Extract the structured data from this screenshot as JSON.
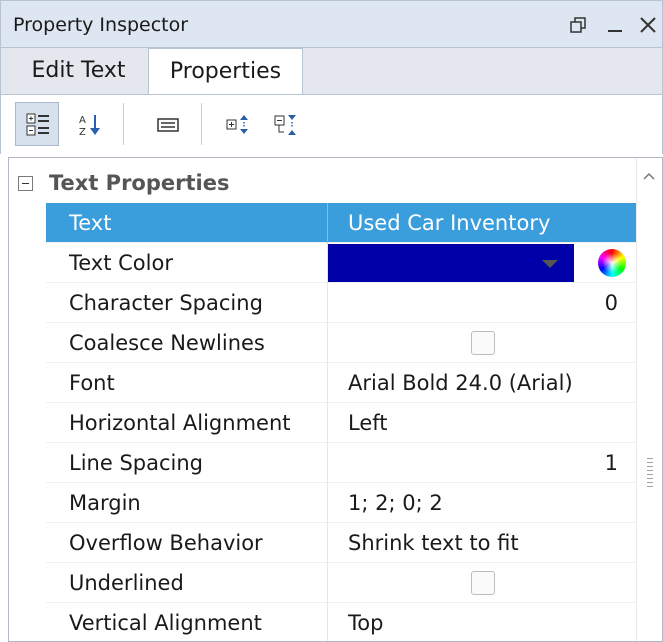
{
  "window": {
    "title": "Property Inspector",
    "buttons": [
      "restore-icon",
      "minimize-icon",
      "close-icon"
    ]
  },
  "tabs": [
    {
      "label": "Edit Text",
      "active": false
    },
    {
      "label": "Properties",
      "active": true
    }
  ],
  "toolbar": {
    "buttons": [
      "categorized-icon",
      "sort-alphabetical-icon",
      "property-pages-icon",
      "expand-all-icon",
      "collapse-all-icon"
    ],
    "active": "categorized-icon"
  },
  "category": {
    "label": "Text Properties",
    "expanded": true
  },
  "properties": [
    {
      "name": "Text",
      "value": "Used Car Inventory",
      "selected": true
    },
    {
      "name": "Text Color",
      "value": "",
      "color": "#0000a8"
    },
    {
      "name": "Character Spacing",
      "value": "0"
    },
    {
      "name": "Coalesce Newlines",
      "value": "",
      "checked": false
    },
    {
      "name": "Font",
      "value": "Arial Bold 24.0 (Arial)"
    },
    {
      "name": "Horizontal Alignment",
      "value": "Left"
    },
    {
      "name": "Line Spacing",
      "value": "1"
    },
    {
      "name": "Margin",
      "value": "1; 2; 0; 2"
    },
    {
      "name": "Overflow Behavior",
      "value": "Shrink text to fit"
    },
    {
      "name": "Underlined",
      "value": "",
      "checked": false
    },
    {
      "name": "Vertical Alignment",
      "value": "Top"
    }
  ],
  "colors": {
    "selection": "#3a9ddc",
    "title_bar": "#dde6f1",
    "text_color_swatch": "#0000a8"
  }
}
